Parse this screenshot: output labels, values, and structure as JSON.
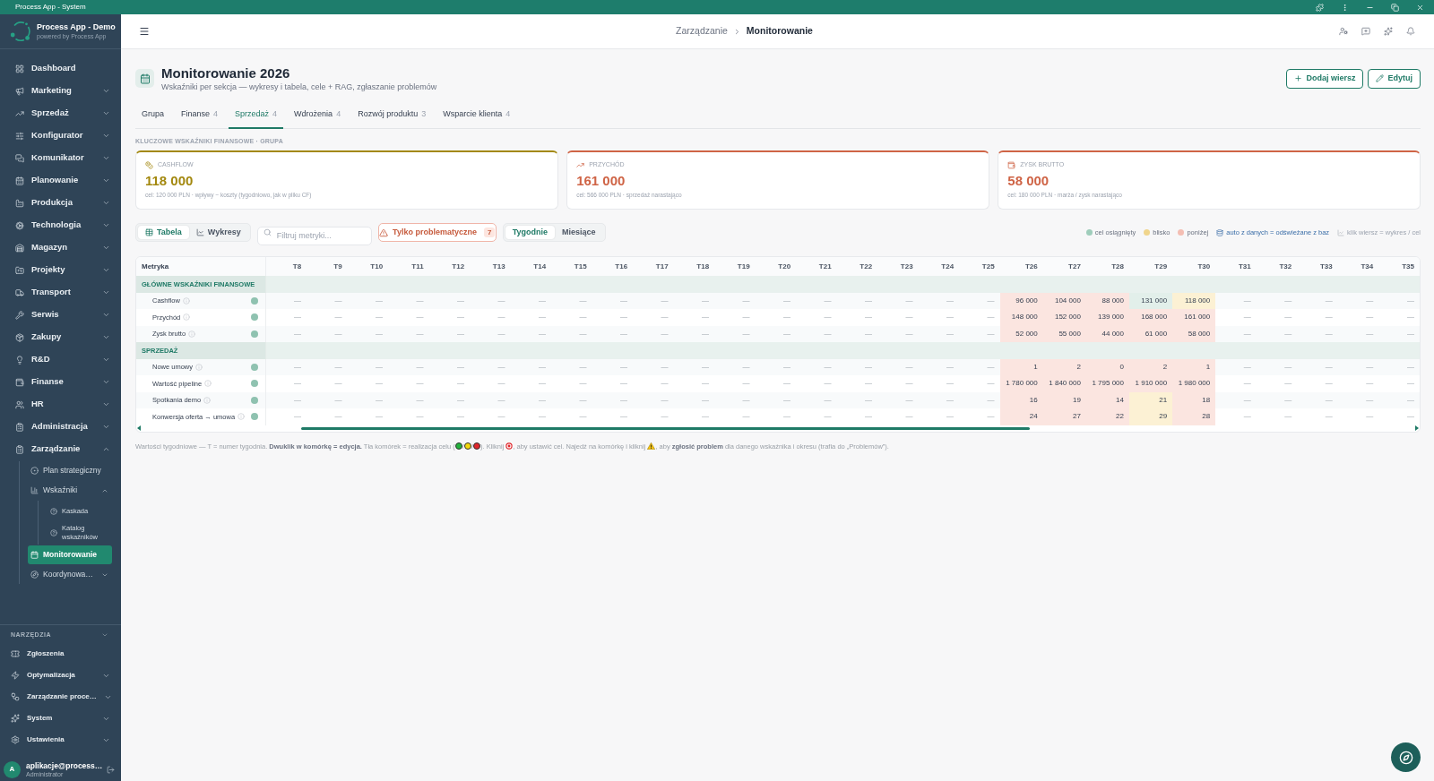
{
  "window": {
    "title": "Process App - System"
  },
  "sidebar": {
    "app_name": "Process App - Demo",
    "tagline": "powered by Process App",
    "nav": [
      {
        "label": "Dashboard",
        "kind": "link",
        "selected": false
      },
      {
        "label": "Marketing",
        "kind": "group",
        "expanded": false,
        "selected": false
      },
      {
        "label": "Sprzedaż",
        "kind": "group",
        "expanded": false,
        "selected": false
      },
      {
        "label": "Konfigurator",
        "kind": "group",
        "expanded": false,
        "selected": false
      },
      {
        "label": "Komunikator",
        "kind": "group",
        "expanded": false,
        "selected": false
      },
      {
        "label": "Planowanie",
        "kind": "group",
        "expanded": false,
        "selected": false
      },
      {
        "label": "Produkcja",
        "kind": "group",
        "expanded": false,
        "selected": false
      },
      {
        "label": "Technologia",
        "kind": "group",
        "expanded": false,
        "selected": false
      },
      {
        "label": "Magazyn",
        "kind": "group",
        "expanded": false,
        "selected": false
      },
      {
        "label": "Projekty",
        "kind": "group",
        "expanded": false,
        "selected": false
      },
      {
        "label": "Transport",
        "kind": "group",
        "expanded": false,
        "selected": false
      },
      {
        "label": "Serwis",
        "kind": "group",
        "expanded": false,
        "selected": false
      },
      {
        "label": "Zakupy",
        "kind": "group",
        "expanded": false,
        "selected": false
      },
      {
        "label": "R&D",
        "kind": "group",
        "expanded": false,
        "selected": false
      },
      {
        "label": "Finanse",
        "kind": "group",
        "expanded": false,
        "selected": false
      },
      {
        "label": "HR",
        "kind": "group",
        "expanded": false,
        "selected": false
      },
      {
        "label": "Administracja",
        "kind": "group",
        "expanded": false,
        "selected": false
      },
      {
        "label": "Zarządzanie",
        "kind": "group",
        "expanded": true,
        "selected": false,
        "children": [
          {
            "label": "Plan strategiczny",
            "kind": "link",
            "selected": false
          },
          {
            "label": "Wskaźniki",
            "kind": "group",
            "expanded": true,
            "selected": false,
            "children": [
              {
                "label": "Kaskada",
                "selected": false
              },
              {
                "label": "Katalog wskaźników",
                "selected": false
              }
            ]
          },
          {
            "label": "Monitorowanie",
            "kind": "link",
            "selected": true
          },
          {
            "label": "Koordynowa…",
            "kind": "group",
            "expanded": false,
            "selected": false
          }
        ]
      }
    ],
    "tools": {
      "label": "NARZĘDZIA",
      "items": [
        {
          "label": "Zgłoszenia",
          "kind": "link",
          "selected": false
        },
        {
          "label": "Optymalizacja",
          "kind": "group",
          "expanded": false,
          "selected": false
        },
        {
          "label": "Zarządzanie proce…",
          "kind": "group",
          "expanded": false,
          "selected": false
        },
        {
          "label": "System",
          "kind": "group",
          "expanded": false,
          "selected": false
        },
        {
          "label": "Ustawienia",
          "kind": "group",
          "expanded": false,
          "selected": false
        }
      ]
    },
    "user": {
      "initial": "A",
      "name": "aplikacje@process…",
      "role": "Administrator"
    }
  },
  "header": {
    "breadcrumb": [
      "Zarządzanie",
      "Monitorowanie"
    ]
  },
  "page": {
    "title": "Monitorowanie 2026",
    "subtitle": "Wskaźniki per sekcja — wykresy i tabela, cele + RAG, zgłaszanie problemów",
    "actions": [
      {
        "label": "Dodaj wiersz"
      },
      {
        "label": "Edytuj"
      }
    ]
  },
  "tabs": [
    {
      "label": "Grupa",
      "selected": false
    },
    {
      "label": "Finanse",
      "count": "4",
      "selected": false
    },
    {
      "label": "Sprzedaż",
      "count": "4",
      "selected": true
    },
    {
      "label": "Wdrożenia",
      "count": "4",
      "selected": false
    },
    {
      "label": "Rozwój produktu",
      "count": "3",
      "selected": false
    },
    {
      "label": "Wsparcie klienta",
      "count": "4",
      "selected": false
    }
  ],
  "kpi": {
    "label": "KLUCZOWE WSKAŹNIKI FINANSOWE · GRUPA",
    "cards": [
      {
        "label": "CASHFLOW",
        "value": "118 000",
        "note": "cel: 120 000 PLN · wpływy − koszty (tygodniowo, jak w pliku CF)",
        "color": "#a3880f"
      },
      {
        "label": "PRZYCHÓD",
        "value": "161 000",
        "note": "cel: 566 000 PLN · sprzedaż narastająco",
        "color": "#cf6446"
      },
      {
        "label": "ZYSK BRUTTO",
        "value": "58 000",
        "note": "cel: 180 000 PLN · marża / zysk narastająco",
        "color": "#cf6446"
      }
    ]
  },
  "toolbar": {
    "views": [
      {
        "label": "Tabela",
        "selected": true
      },
      {
        "label": "Wykresy",
        "selected": false
      }
    ],
    "filter": {
      "placeholder": "Filtruj metryki..."
    },
    "problems_filter": {
      "label": "Tylko problematyczne",
      "count": "7"
    },
    "periods": [
      {
        "label": "Tygodnie",
        "selected": true
      },
      {
        "label": "Miesiące",
        "selected": false
      }
    ],
    "legend": [
      {
        "kind": "swatch",
        "label": "cel osiągnięty",
        "color": "#9fcdbb"
      },
      {
        "kind": "swatch",
        "label": "blisko",
        "color": "#f0d58c"
      },
      {
        "kind": "swatch",
        "label": "poniżej",
        "color": "#f4beb3"
      },
      {
        "kind": "source",
        "label": "auto z danych = odświeżane z baz"
      },
      {
        "kind": "hint",
        "label": "klik wiersz = wykres / cel"
      }
    ]
  },
  "table": {
    "first_column": "Metryka",
    "columns": [
      "T8",
      "T9",
      "T10",
      "T11",
      "T12",
      "T13",
      "T14",
      "T15",
      "T16",
      "T17",
      "T18",
      "T19",
      "T20",
      "T21",
      "T22",
      "T23",
      "T24",
      "T25",
      "T26",
      "T27",
      "T28",
      "T29",
      "T30",
      "T31",
      "T32",
      "T33",
      "T34",
      "T35"
    ],
    "groups": [
      {
        "label": "GŁÓWNE WSKAŹNIKI FINANSOWE",
        "metrics": [
          {
            "name": "Cashflow",
            "color": "#8fc2b0",
            "cells": [
              {
                "text": "—"
              },
              {
                "text": "—"
              },
              {
                "text": "—"
              },
              {
                "text": "—"
              },
              {
                "text": "—"
              },
              {
                "text": "—"
              },
              {
                "text": "—"
              },
              {
                "text": "—"
              },
              {
                "text": "—"
              },
              {
                "text": "—"
              },
              {
                "text": "—"
              },
              {
                "text": "—"
              },
              {
                "text": "—"
              },
              {
                "text": "—"
              },
              {
                "text": "—"
              },
              {
                "text": "—"
              },
              {
                "text": "—"
              },
              {
                "text": "—"
              },
              {
                "text": "96 000",
                "color": "#fbe5e0"
              },
              {
                "text": "104 000",
                "color": "#fbe5e0"
              },
              {
                "text": "88 000",
                "color": "#fbe5e0"
              },
              {
                "text": "131 000",
                "color": "#e2efea"
              },
              {
                "text": "118 000",
                "color": "#fcf1d4"
              },
              {
                "text": "—"
              },
              {
                "text": "—"
              },
              {
                "text": "—"
              },
              {
                "text": "—"
              },
              {
                "text": "—"
              }
            ]
          },
          {
            "name": "Przychód",
            "color": "#8fc2b0",
            "cells": [
              {
                "text": "—"
              },
              {
                "text": "—"
              },
              {
                "text": "—"
              },
              {
                "text": "—"
              },
              {
                "text": "—"
              },
              {
                "text": "—"
              },
              {
                "text": "—"
              },
              {
                "text": "—"
              },
              {
                "text": "—"
              },
              {
                "text": "—"
              },
              {
                "text": "—"
              },
              {
                "text": "—"
              },
              {
                "text": "—"
              },
              {
                "text": "—"
              },
              {
                "text": "—"
              },
              {
                "text": "—"
              },
              {
                "text": "—"
              },
              {
                "text": "—"
              },
              {
                "text": "148 000",
                "color": "#fbe5e0"
              },
              {
                "text": "152 000",
                "color": "#fbe5e0"
              },
              {
                "text": "139 000",
                "color": "#fbe5e0"
              },
              {
                "text": "168 000",
                "color": "#fbe5e0"
              },
              {
                "text": "161 000",
                "color": "#fbe5e0"
              },
              {
                "text": "—"
              },
              {
                "text": "—"
              },
              {
                "text": "—"
              },
              {
                "text": "—"
              },
              {
                "text": "—"
              }
            ]
          },
          {
            "name": "Zysk brutto",
            "color": "#8fc2b0",
            "cells": [
              {
                "text": "—"
              },
              {
                "text": "—"
              },
              {
                "text": "—"
              },
              {
                "text": "—"
              },
              {
                "text": "—"
              },
              {
                "text": "—"
              },
              {
                "text": "—"
              },
              {
                "text": "—"
              },
              {
                "text": "—"
              },
              {
                "text": "—"
              },
              {
                "text": "—"
              },
              {
                "text": "—"
              },
              {
                "text": "—"
              },
              {
                "text": "—"
              },
              {
                "text": "—"
              },
              {
                "text": "—"
              },
              {
                "text": "—"
              },
              {
                "text": "—"
              },
              {
                "text": "52 000",
                "color": "#fbe5e0"
              },
              {
                "text": "55 000",
                "color": "#fbe5e0"
              },
              {
                "text": "44 000",
                "color": "#fbe5e0"
              },
              {
                "text": "61 000",
                "color": "#fbe5e0"
              },
              {
                "text": "58 000",
                "color": "#fbe5e0"
              },
              {
                "text": "—"
              },
              {
                "text": "—"
              },
              {
                "text": "—"
              },
              {
                "text": "—"
              },
              {
                "text": "—"
              }
            ]
          }
        ]
      },
      {
        "label": "SPRZEDAŻ",
        "metrics": [
          {
            "name": "Nowe umowy",
            "color": "#8fc2b0",
            "cells": [
              {
                "text": "—"
              },
              {
                "text": "—"
              },
              {
                "text": "—"
              },
              {
                "text": "—"
              },
              {
                "text": "—"
              },
              {
                "text": "—"
              },
              {
                "text": "—"
              },
              {
                "text": "—"
              },
              {
                "text": "—"
              },
              {
                "text": "—"
              },
              {
                "text": "—"
              },
              {
                "text": "—"
              },
              {
                "text": "—"
              },
              {
                "text": "—"
              },
              {
                "text": "—"
              },
              {
                "text": "—"
              },
              {
                "text": "—"
              },
              {
                "text": "—"
              },
              {
                "text": "1",
                "color": "#fbe5e0"
              },
              {
                "text": "2",
                "color": "#fbe5e0"
              },
              {
                "text": "0",
                "color": "#fbe5e0"
              },
              {
                "text": "2",
                "color": "#fbe5e0"
              },
              {
                "text": "1",
                "color": "#fbe5e0"
              },
              {
                "text": "—"
              },
              {
                "text": "—"
              },
              {
                "text": "—"
              },
              {
                "text": "—"
              },
              {
                "text": "—"
              }
            ]
          },
          {
            "name": "Wartość pipeline",
            "color": "#8fc2b0",
            "cells": [
              {
                "text": "—"
              },
              {
                "text": "—"
              },
              {
                "text": "—"
              },
              {
                "text": "—"
              },
              {
                "text": "—"
              },
              {
                "text": "—"
              },
              {
                "text": "—"
              },
              {
                "text": "—"
              },
              {
                "text": "—"
              },
              {
                "text": "—"
              },
              {
                "text": "—"
              },
              {
                "text": "—"
              },
              {
                "text": "—"
              },
              {
                "text": "—"
              },
              {
                "text": "—"
              },
              {
                "text": "—"
              },
              {
                "text": "—"
              },
              {
                "text": "—"
              },
              {
                "text": "1 780 000",
                "color": "#fbe5e0"
              },
              {
                "text": "1 840 000",
                "color": "#fbe5e0"
              },
              {
                "text": "1 795 000",
                "color": "#fbe5e0"
              },
              {
                "text": "1 910 000",
                "color": "#fbe5e0"
              },
              {
                "text": "1 980 000",
                "color": "#fbe5e0"
              },
              {
                "text": "—"
              },
              {
                "text": "—"
              },
              {
                "text": "—"
              },
              {
                "text": "—"
              },
              {
                "text": "—"
              }
            ]
          },
          {
            "name": "Spotkania demo",
            "color": "#8fc2b0",
            "cells": [
              {
                "text": "—"
              },
              {
                "text": "—"
              },
              {
                "text": "—"
              },
              {
                "text": "—"
              },
              {
                "text": "—"
              },
              {
                "text": "—"
              },
              {
                "text": "—"
              },
              {
                "text": "—"
              },
              {
                "text": "—"
              },
              {
                "text": "—"
              },
              {
                "text": "—"
              },
              {
                "text": "—"
              },
              {
                "text": "—"
              },
              {
                "text": "—"
              },
              {
                "text": "—"
              },
              {
                "text": "—"
              },
              {
                "text": "—"
              },
              {
                "text": "—"
              },
              {
                "text": "16",
                "color": "#fbe5e0"
              },
              {
                "text": "19",
                "color": "#fbe5e0"
              },
              {
                "text": "14",
                "color": "#fbe5e0"
              },
              {
                "text": "21",
                "color": "#fcf1d4"
              },
              {
                "text": "18",
                "color": "#fbe5e0"
              },
              {
                "text": "—"
              },
              {
                "text": "—"
              },
              {
                "text": "—"
              },
              {
                "text": "—"
              },
              {
                "text": "—"
              }
            ]
          },
          {
            "name": "Konwersja oferta → umowa",
            "color": "#8fc2b0",
            "cells": [
              {
                "text": "—"
              },
              {
                "text": "—"
              },
              {
                "text": "—"
              },
              {
                "text": "—"
              },
              {
                "text": "—"
              },
              {
                "text": "—"
              },
              {
                "text": "—"
              },
              {
                "text": "—"
              },
              {
                "text": "—"
              },
              {
                "text": "—"
              },
              {
                "text": "—"
              },
              {
                "text": "—"
              },
              {
                "text": "—"
              },
              {
                "text": "—"
              },
              {
                "text": "—"
              },
              {
                "text": "—"
              },
              {
                "text": "—"
              },
              {
                "text": "—"
              },
              {
                "text": "24",
                "color": "#fbe5e0"
              },
              {
                "text": "27",
                "color": "#fbe5e0"
              },
              {
                "text": "22",
                "color": "#fbe5e0"
              },
              {
                "text": "29",
                "color": "#fcf1d4"
              },
              {
                "text": "28",
                "color": "#fbe5e0"
              },
              {
                "text": "—"
              },
              {
                "text": "—"
              },
              {
                "text": "—"
              },
              {
                "text": "—"
              },
              {
                "text": "—"
              }
            ]
          }
        ]
      }
    ]
  },
  "footnote": [
    {
      "kind": "text",
      "text": "Wartości tygodniowe — T = numer tygodnia. **Dwuklik w komórkę = edycja.** Tła komórek = realizacja celu ("
    },
    {
      "kind": "dot",
      "color": "#22b33c"
    },
    {
      "kind": "text",
      "text": "/"
    },
    {
      "kind": "dot",
      "color": "#f4d80b"
    },
    {
      "kind": "text",
      "text": "/"
    },
    {
      "kind": "dot",
      "color": "#e0262b"
    },
    {
      "kind": "text",
      "text": "). Kliknij "
    },
    {
      "kind": "target"
    },
    {
      "kind": "text",
      "text": ", aby ustawić cel. Najedź na komórkę i kliknij "
    },
    {
      "kind": "warning"
    },
    {
      "kind": "text",
      "text": ", aby **zgłosić problem** dla danego wskaźnika i okresu (trafia do „Problemów”)."
    }
  ]
}
